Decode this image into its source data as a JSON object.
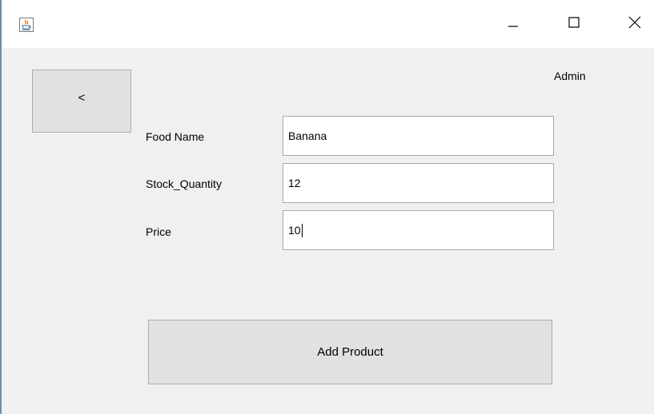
{
  "titlebar": {
    "app_icon": "java-icon",
    "minimize_icon": "minimize-icon",
    "maximize_icon": "maximize-icon",
    "close_icon": "close-icon"
  },
  "header": {
    "back_label": "<",
    "user_label": "Admin"
  },
  "form": {
    "fields": [
      {
        "label": "Food Name",
        "value": "Banana"
      },
      {
        "label": "Stock_Quantity",
        "value": "12"
      },
      {
        "label": "Price",
        "value": "10"
      }
    ],
    "submit_label": "Add Product"
  },
  "colors": {
    "window_border": "#6b8eb0",
    "panel_background": "#f0f0f0",
    "button_background": "#e1e1e1"
  }
}
